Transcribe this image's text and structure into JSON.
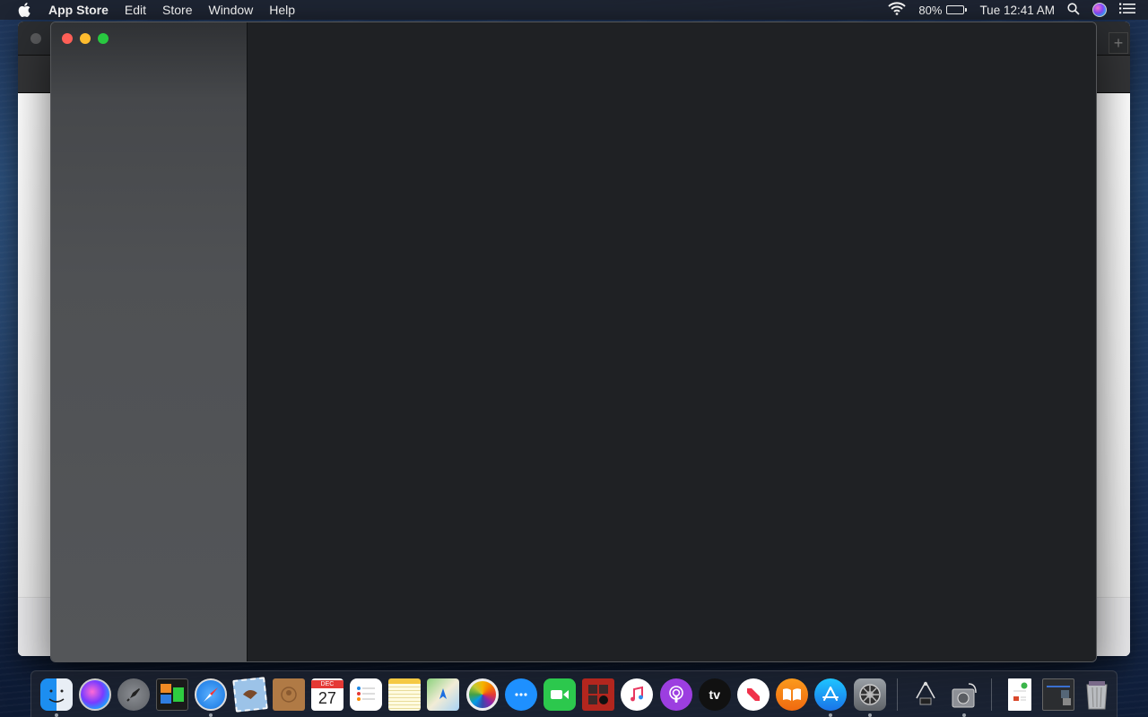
{
  "menubar": {
    "apple_icon": "apple-logo-icon",
    "app_name": "App Store",
    "menus": [
      "Edit",
      "Store",
      "Window",
      "Help"
    ],
    "status": {
      "wifi_icon": "wifi-icon",
      "battery_percent_label": "80%",
      "battery_level": 0.8,
      "clock": "Tue 12:41 AM",
      "spotlight_icon": "search-icon",
      "siri_icon": "siri-icon",
      "notification_center_icon": "list-icon"
    }
  },
  "background_window": {
    "app": "App Store",
    "new_tab_label": "+"
  },
  "front_window": {
    "traffic_lights": [
      "close",
      "minimize",
      "zoom"
    ]
  },
  "dock": {
    "apps": [
      {
        "name": "Finder",
        "icon": "finder-icon",
        "running": true
      },
      {
        "name": "Siri",
        "icon": "siri-icon",
        "running": false
      },
      {
        "name": "Launchpad",
        "icon": "rocket-icon",
        "running": false
      },
      {
        "name": "Mission Control",
        "icon": "mission-control-icon",
        "running": false
      },
      {
        "name": "Safari",
        "icon": "compass-icon",
        "running": true
      },
      {
        "name": "Mail",
        "icon": "mail-stamp-icon",
        "running": false
      },
      {
        "name": "Contacts",
        "icon": "contacts-book-icon",
        "running": false
      },
      {
        "name": "Calendar",
        "icon": "calendar-icon",
        "running": false,
        "month": "DEC",
        "day": "27"
      },
      {
        "name": "Reminders",
        "icon": "reminders-list-icon",
        "running": false
      },
      {
        "name": "Notes",
        "icon": "notepad-icon",
        "running": false
      },
      {
        "name": "Maps",
        "icon": "map-icon",
        "running": false
      },
      {
        "name": "Photos",
        "icon": "photos-flower-icon",
        "running": false
      },
      {
        "name": "Messages",
        "icon": "speech-bubble-icon",
        "running": false
      },
      {
        "name": "FaceTime",
        "icon": "video-camera-icon",
        "running": false
      },
      {
        "name": "Photo Booth",
        "icon": "photo-booth-icon",
        "running": false
      },
      {
        "name": "Music",
        "icon": "music-note-icon",
        "running": false
      },
      {
        "name": "Podcasts",
        "icon": "podcast-icon",
        "running": false
      },
      {
        "name": "TV",
        "icon": "apple-tv-icon",
        "running": false,
        "label": "tv"
      },
      {
        "name": "News",
        "icon": "news-icon",
        "running": false
      },
      {
        "name": "Books",
        "icon": "open-book-icon",
        "running": false
      },
      {
        "name": "App Store",
        "icon": "app-store-icon",
        "running": true
      },
      {
        "name": "System Preferences",
        "icon": "gear-icon",
        "running": true
      }
    ],
    "utilities": [
      {
        "name": "System Information",
        "icon": "caliper-chip-icon",
        "running": false
      },
      {
        "name": "Disk Utility",
        "icon": "disk-stethoscope-icon",
        "running": true
      }
    ],
    "stacks": [
      {
        "name": "Document",
        "icon": "document-icon"
      },
      {
        "name": "Screenshot",
        "icon": "screenshot-icon"
      },
      {
        "name": "Trash",
        "icon": "trash-icon"
      }
    ]
  }
}
